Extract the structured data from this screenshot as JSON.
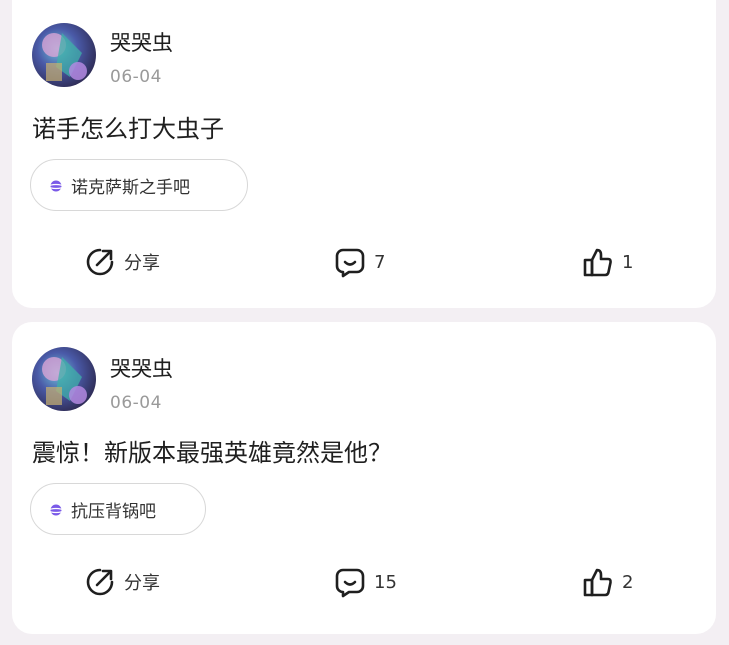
{
  "posts": [
    {
      "author": "哭哭虫",
      "date": "06-04",
      "text": "诺手怎么打大虫子",
      "tag": "诺克萨斯之手吧",
      "share_label": "分享",
      "comment_count": "7",
      "like_count": "1"
    },
    {
      "author": "哭哭虫",
      "date": "06-04",
      "text": "震惊！新版本最强英雄竟然是他？",
      "tag": "抗压背锅吧",
      "share_label": "分享",
      "comment_count": "15",
      "like_count": "2"
    }
  ],
  "icons": {
    "share": "share-icon",
    "comment": "comment-icon",
    "like": "thumbs-up-icon",
    "tag": "planet-icon"
  },
  "colors": {
    "tag_icon": "#7a5ae8",
    "background": "#f3eff3",
    "card": "#ffffff"
  }
}
